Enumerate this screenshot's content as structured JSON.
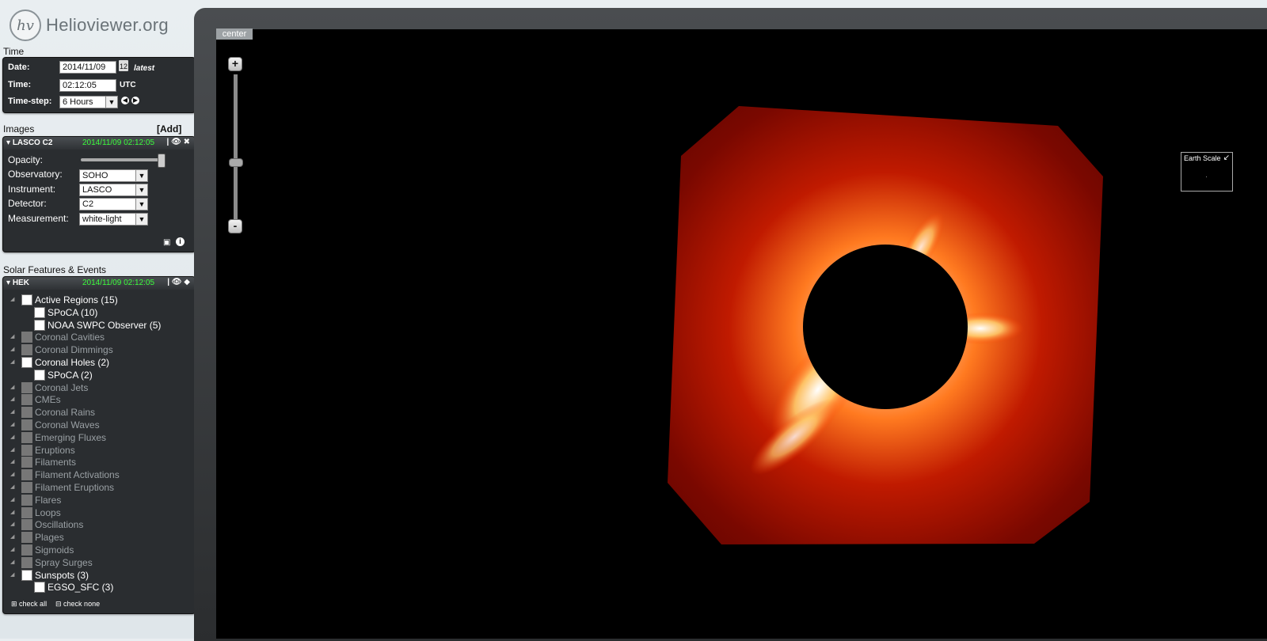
{
  "app": {
    "logo_mark": "hv",
    "title": "Helioviewer.org"
  },
  "time": {
    "section_title": "Time",
    "date_label": "Date:",
    "date_value": "2014/11/09",
    "calendar_day": "12",
    "latest_link": "latest",
    "time_label": "Time:",
    "time_value": "02:12:05",
    "time_zone": "UTC",
    "timestep_label": "Time-step:",
    "timestep_value": "6 Hours"
  },
  "images": {
    "section_title": "Images",
    "add_link": "[Add]",
    "layer": {
      "name": "LASCO C2",
      "timestamp": "2014/11/09 02:12:05",
      "opacity_label": "Opacity:",
      "opacity_value": 1.0,
      "observatory_label": "Observatory:",
      "observatory_value": "SOHO",
      "instrument_label": "Instrument:",
      "instrument_value": "LASCO",
      "detector_label": "Detector:",
      "detector_value": "C2",
      "measurement_label": "Measurement:",
      "measurement_value": "white-light"
    }
  },
  "features": {
    "section_title": "Solar Features & Events",
    "source": {
      "name": "HEK",
      "timestamp": "2014/11/09 02:12:05"
    },
    "items": [
      {
        "label": "Active Regions (15)",
        "level": 0,
        "active": true
      },
      {
        "label": "SPoCA (10)",
        "level": 1,
        "active": true
      },
      {
        "label": "NOAA SWPC Observer (5)",
        "level": 1,
        "active": true
      },
      {
        "label": "Coronal Cavities",
        "level": 0,
        "active": false
      },
      {
        "label": "Coronal Dimmings",
        "level": 0,
        "active": false
      },
      {
        "label": "Coronal Holes (2)",
        "level": 0,
        "active": true
      },
      {
        "label": "SPoCA (2)",
        "level": 1,
        "active": true
      },
      {
        "label": "Coronal Jets",
        "level": 0,
        "active": false
      },
      {
        "label": "CMEs",
        "level": 0,
        "active": false
      },
      {
        "label": "Coronal Rains",
        "level": 0,
        "active": false
      },
      {
        "label": "Coronal Waves",
        "level": 0,
        "active": false
      },
      {
        "label": "Emerging Fluxes",
        "level": 0,
        "active": false
      },
      {
        "label": "Eruptions",
        "level": 0,
        "active": false
      },
      {
        "label": "Filaments",
        "level": 0,
        "active": false
      },
      {
        "label": "Filament Activations",
        "level": 0,
        "active": false
      },
      {
        "label": "Filament Eruptions",
        "level": 0,
        "active": false
      },
      {
        "label": "Flares",
        "level": 0,
        "active": false
      },
      {
        "label": "Loops",
        "level": 0,
        "active": false
      },
      {
        "label": "Oscillations",
        "level": 0,
        "active": false
      },
      {
        "label": "Plages",
        "level": 0,
        "active": false
      },
      {
        "label": "Sigmoids",
        "level": 0,
        "active": false
      },
      {
        "label": "Spray Surges",
        "level": 0,
        "active": false
      },
      {
        "label": "Sunspots (3)",
        "level": 0,
        "active": true
      },
      {
        "label": "EGSO_SFC (3)",
        "level": 1,
        "active": true
      }
    ],
    "check_all": "check all",
    "check_none": "check none"
  },
  "viewport": {
    "center_button": "center",
    "zoom_in": "+",
    "zoom_out": "-",
    "earth_scale_label": "Earth Scale"
  },
  "colors": {
    "timestamp_green": "#3cff3c",
    "panel_dark": "#2a2d30",
    "corona_red": "#8a0a00"
  }
}
